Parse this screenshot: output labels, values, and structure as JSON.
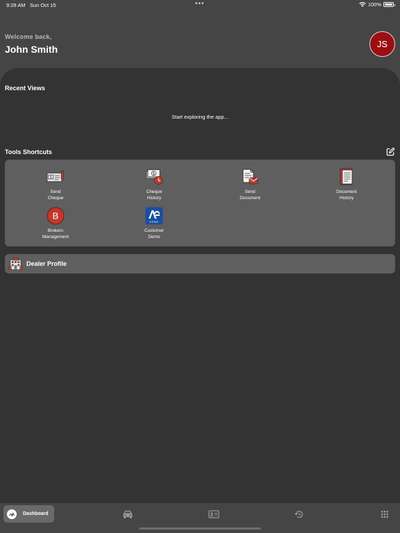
{
  "status_bar": {
    "time": "9:28 AM",
    "date": "Sun Oct 15",
    "battery": "100%"
  },
  "header": {
    "welcome": "Welcome back,",
    "user_name": "John Smith",
    "avatar_initials": "JS"
  },
  "recent_views": {
    "title": "Recent Views",
    "empty_text": "Start exploring the app..."
  },
  "tools": {
    "title": "Tools Shortcuts",
    "items": [
      {
        "label": "Send\nCheque",
        "icon": "cheque-send-icon"
      },
      {
        "label": "Cheque\nHistory",
        "icon": "cheque-history-icon"
      },
      {
        "label": "Send\nDocument",
        "icon": "document-send-icon"
      },
      {
        "label": "Document\nHistory",
        "icon": "document-history-icon"
      },
      {
        "label": "Brokers\nManagement",
        "icon": "brokers-icon",
        "badge": "B"
      },
      {
        "label": "Customer\nDemo",
        "icon": "customer-demo-icon",
        "badge": "DEMO"
      }
    ]
  },
  "dealer": {
    "label": "Dealer Profile",
    "icon": "dealership-icon"
  },
  "tab_bar": {
    "items": [
      {
        "label": "Dashboard",
        "icon": "gauge-icon",
        "active": true
      },
      {
        "icon": "car-icon"
      },
      {
        "icon": "id-card-icon"
      },
      {
        "icon": "history-icon"
      },
      {
        "icon": "grid-icon"
      }
    ]
  },
  "colors": {
    "background": "#454545",
    "panel": "#333333",
    "card": "#5f5f5f",
    "accent_red": "#9b0e12",
    "demo_blue": "#1a4fa0"
  }
}
